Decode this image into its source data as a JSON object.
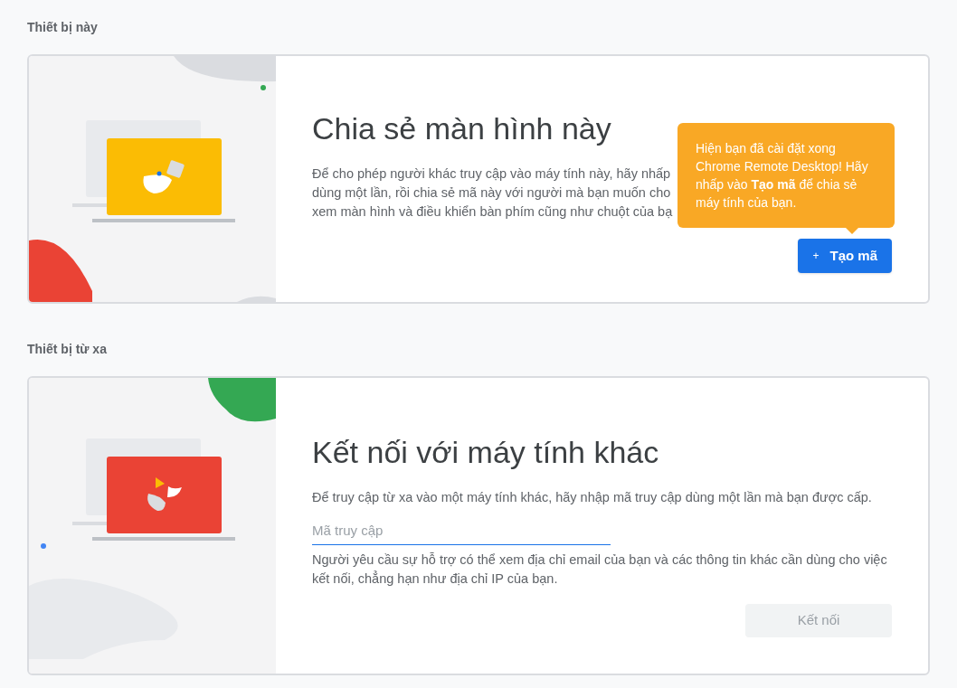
{
  "sections": [
    {
      "kind": "share",
      "heading": "Thiết bị này",
      "title": "Chia sẻ màn hình này",
      "description_lines": [
        "Để cho phép người khác truy cập vào máy tính này, hãy nhấp",
        "dùng một lần, rồi chia sẻ mã này với người mà bạn muốn cho",
        "xem màn hình và điều khiển bàn phím cũng như chuột của bạ"
      ],
      "tooltip": "Hiện bạn đã cài đặt xong Chrome Remote Desktop! Hãy nhấp vào **Tạo mã** để chia sẻ máy tính của bạn.",
      "button": {
        "icon": "+",
        "label": "Tạo mã",
        "disabled": false
      }
    },
    {
      "kind": "connect",
      "heading": "Thiết bị từ xa",
      "title": "Kết nối với máy tính khác",
      "description": "Để truy cập từ xa vào một máy tính khác, hãy nhập mã truy cập dùng một lần mà bạn được cấp.",
      "input": {
        "placeholder": "Mã truy cập"
      },
      "note": "Người yêu cầu sự hỗ trợ có thể xem địa chỉ email của bạn và các thông tin khác cần dùng cho việc kết nối, chẳng hạn như địa chỉ IP của bạn.",
      "button": {
        "label": "Kết nối",
        "disabled": true
      }
    }
  ]
}
